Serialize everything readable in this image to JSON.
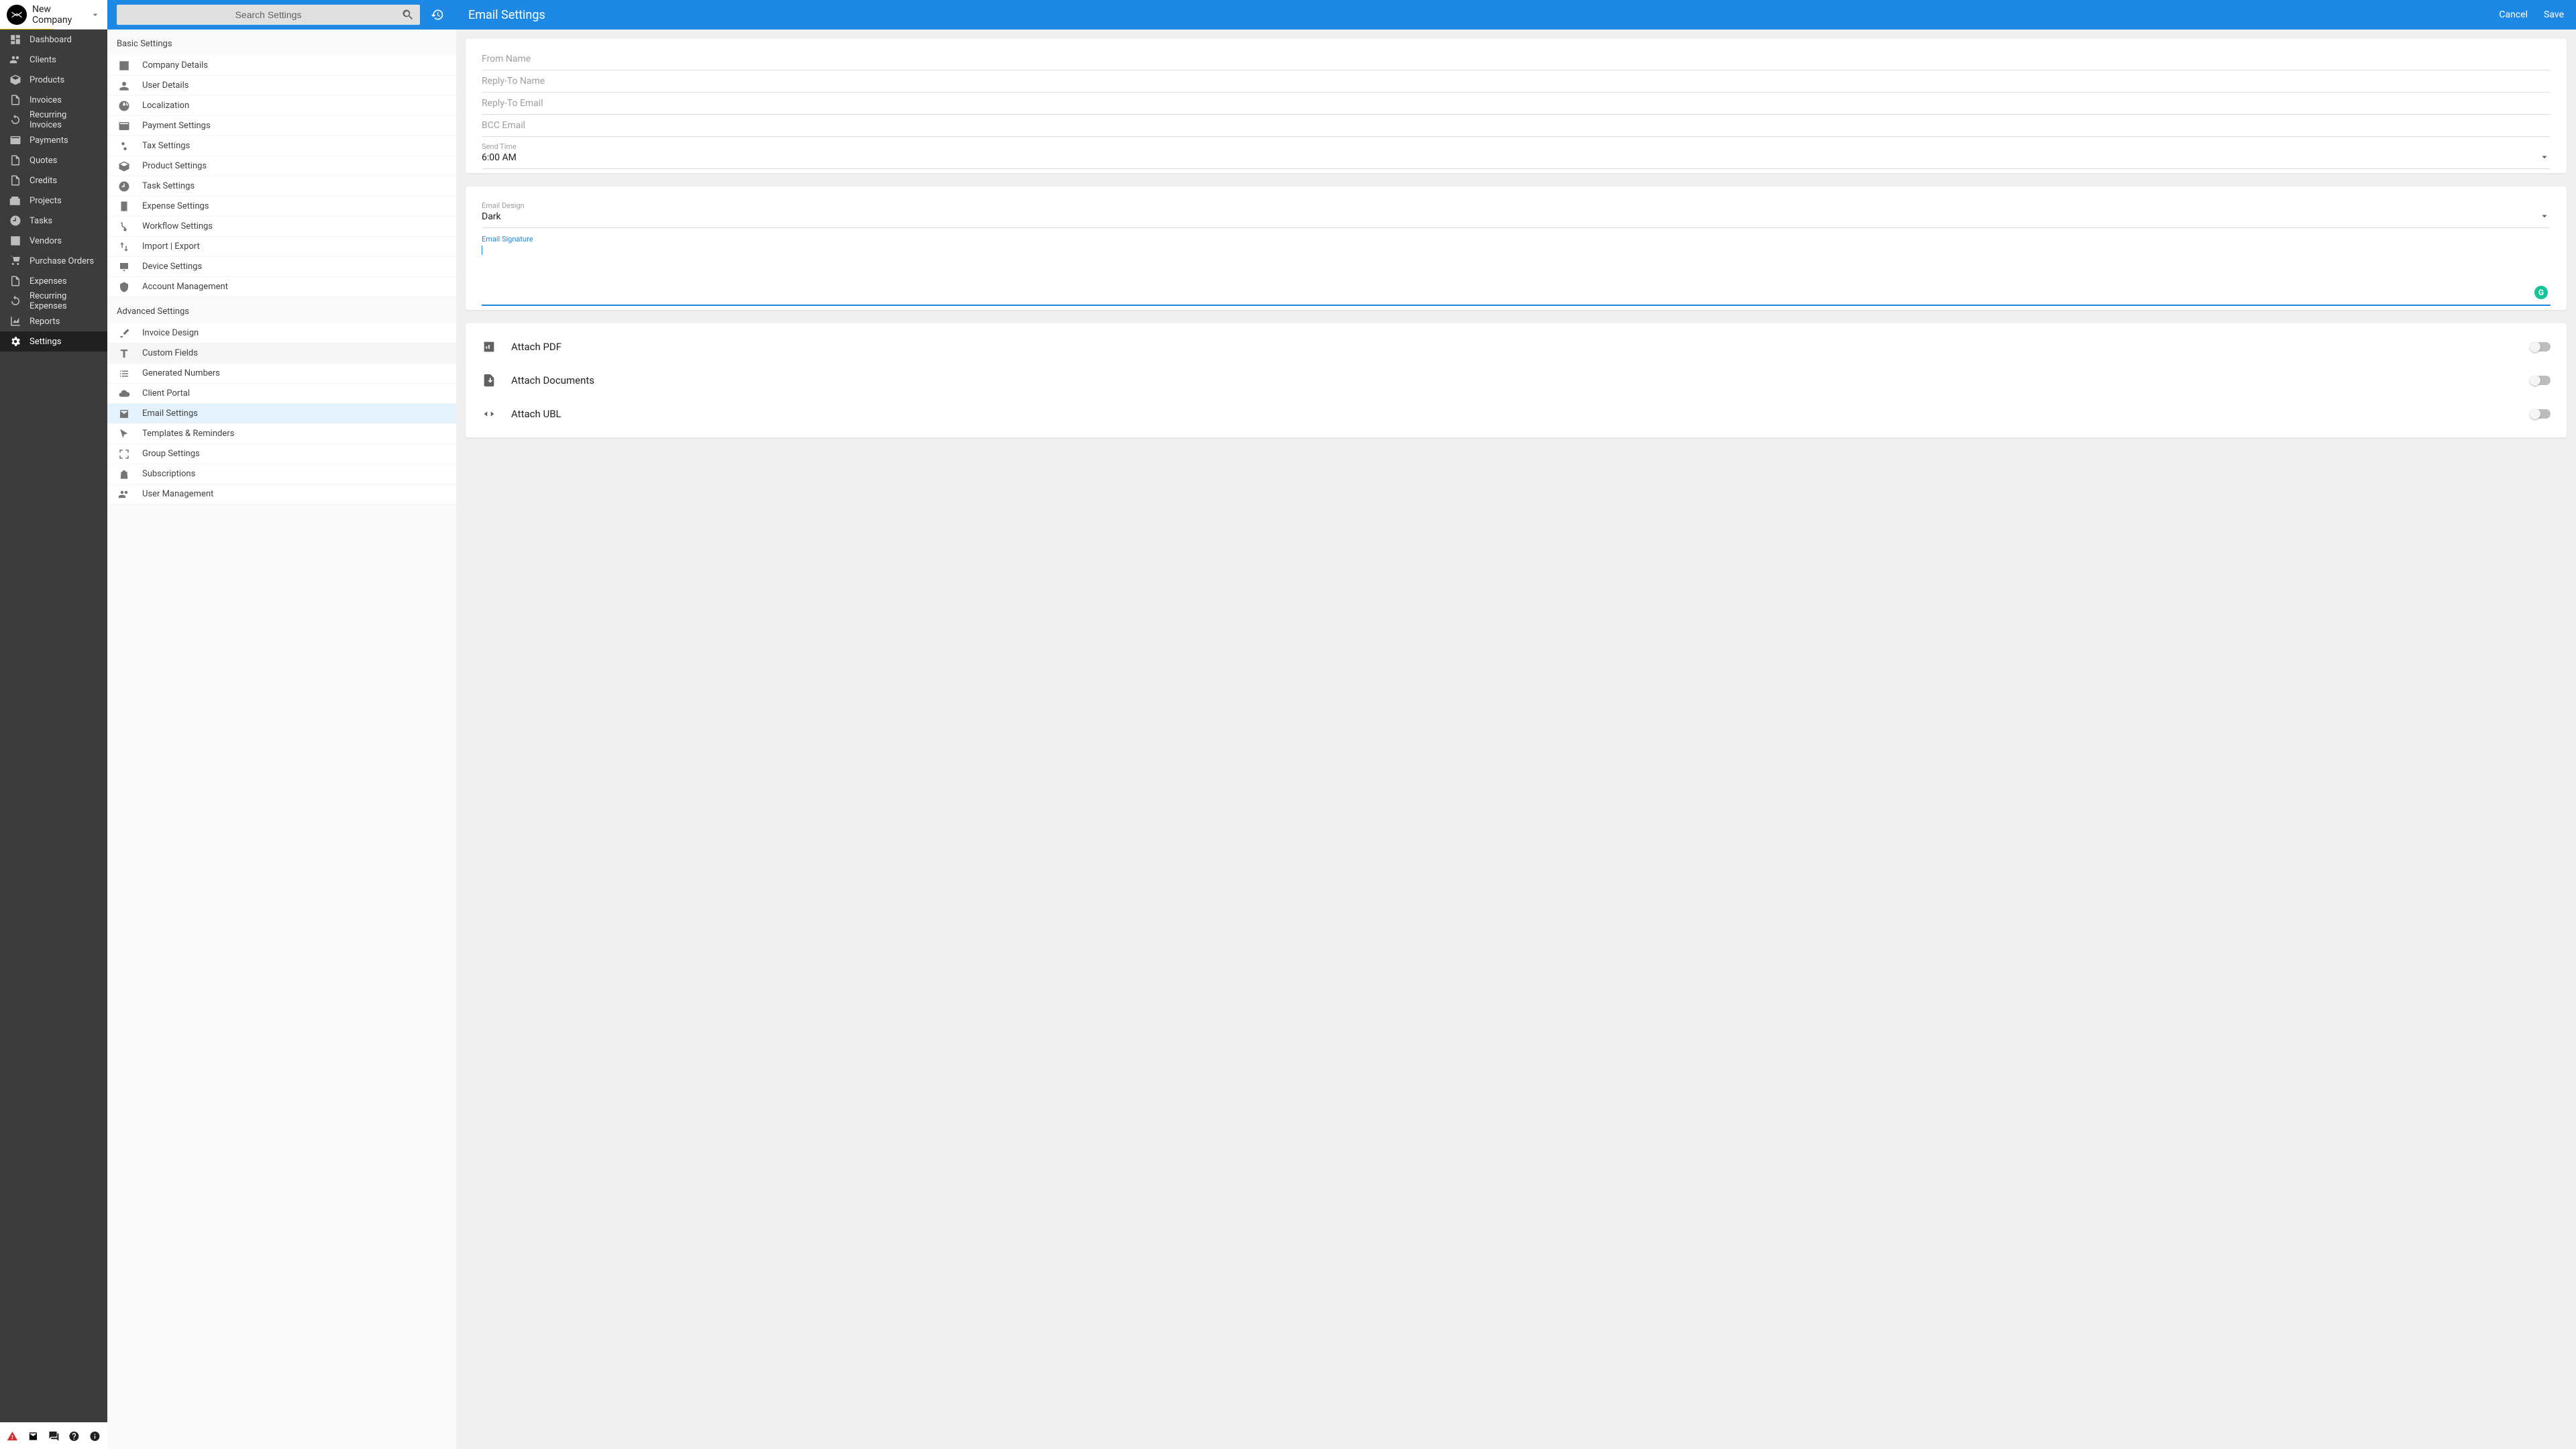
{
  "company": {
    "name": "New Company"
  },
  "search": {
    "placeholder": "Search Settings"
  },
  "nav": {
    "items": [
      {
        "label": "Dashboard",
        "icon": "dashboard"
      },
      {
        "label": "Clients",
        "icon": "people"
      },
      {
        "label": "Products",
        "icon": "box"
      },
      {
        "label": "Invoices",
        "icon": "doc"
      },
      {
        "label": "Recurring Invoices",
        "icon": "recurring"
      },
      {
        "label": "Payments",
        "icon": "card"
      },
      {
        "label": "Quotes",
        "icon": "doc"
      },
      {
        "label": "Credits",
        "icon": "doc"
      },
      {
        "label": "Projects",
        "icon": "briefcase"
      },
      {
        "label": "Tasks",
        "icon": "clock"
      },
      {
        "label": "Vendors",
        "icon": "building"
      },
      {
        "label": "Purchase Orders",
        "icon": "cart"
      },
      {
        "label": "Expenses",
        "icon": "doc"
      },
      {
        "label": "Recurring Expenses",
        "icon": "recurring"
      },
      {
        "label": "Reports",
        "icon": "chart"
      },
      {
        "label": "Settings",
        "icon": "gear",
        "active": true
      }
    ]
  },
  "settings_groups": {
    "basic": {
      "title": "Basic Settings",
      "items": [
        {
          "label": "Company Details",
          "icon": "building"
        },
        {
          "label": "User Details",
          "icon": "person"
        },
        {
          "label": "Localization",
          "icon": "globe"
        },
        {
          "label": "Payment Settings",
          "icon": "card"
        },
        {
          "label": "Tax Settings",
          "icon": "percent"
        },
        {
          "label": "Product Settings",
          "icon": "box"
        },
        {
          "label": "Task Settings",
          "icon": "clock"
        },
        {
          "label": "Expense Settings",
          "icon": "receipt"
        },
        {
          "label": "Workflow Settings",
          "icon": "branch"
        },
        {
          "label": "Import | Export",
          "icon": "swap"
        },
        {
          "label": "Device Settings",
          "icon": "desktop"
        },
        {
          "label": "Account Management",
          "icon": "shield"
        }
      ]
    },
    "advanced": {
      "title": "Advanced Settings",
      "items": [
        {
          "label": "Invoice Design",
          "icon": "brush"
        },
        {
          "label": "Custom Fields",
          "icon": "text",
          "hover": true
        },
        {
          "label": "Generated Numbers",
          "icon": "list"
        },
        {
          "label": "Client Portal",
          "icon": "cloud"
        },
        {
          "label": "Email Settings",
          "icon": "mail",
          "selected": true
        },
        {
          "label": "Templates & Reminders",
          "icon": "pointer"
        },
        {
          "label": "Group Settings",
          "icon": "frame"
        },
        {
          "label": "Subscriptions",
          "icon": "bag"
        },
        {
          "label": "User Management",
          "icon": "people"
        }
      ]
    }
  },
  "detail": {
    "title": "Email Settings",
    "actions": {
      "cancel": "Cancel",
      "save": "Save"
    },
    "fields": {
      "from_name": "From Name",
      "reply_to_name": "Reply-To Name",
      "reply_to_email": "Reply-To Email",
      "bcc_email": "BCC Email",
      "send_time_label": "Send Time",
      "send_time_value": "6:00 AM",
      "email_design_label": "Email Design",
      "email_design_value": "Dark",
      "email_signature_label": "Email Signature"
    },
    "toggles": [
      {
        "label": "Attach PDF",
        "icon": "pdf"
      },
      {
        "label": "Attach Documents",
        "icon": "attach"
      },
      {
        "label": "Attach UBL",
        "icon": "code"
      }
    ]
  }
}
